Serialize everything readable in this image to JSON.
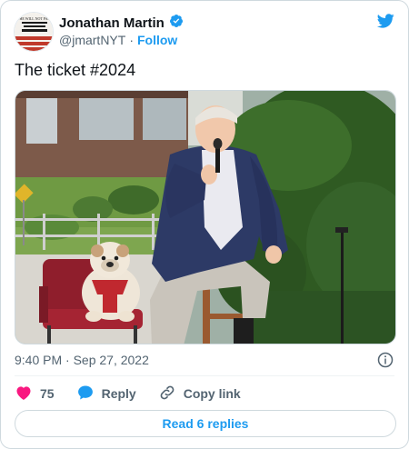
{
  "author": {
    "display_name": "Jonathan Martin",
    "handle": "@jmartNYT",
    "separator": "·",
    "follow_label": "Follow",
    "avatar_text": "THE WILL NOT PASS"
  },
  "tweet": {
    "text": "The ticket #2024",
    "timestamp": "9:40 PM · Sep 27, 2022"
  },
  "actions": {
    "like_count": "75",
    "reply_label": "Reply",
    "copy_link_label": "Copy link"
  },
  "footer": {
    "read_replies_label": "Read 6 replies"
  },
  "colors": {
    "accent": "#1d9bf0",
    "like": "#f91880",
    "text": "#0f1419",
    "muted": "#536471"
  }
}
